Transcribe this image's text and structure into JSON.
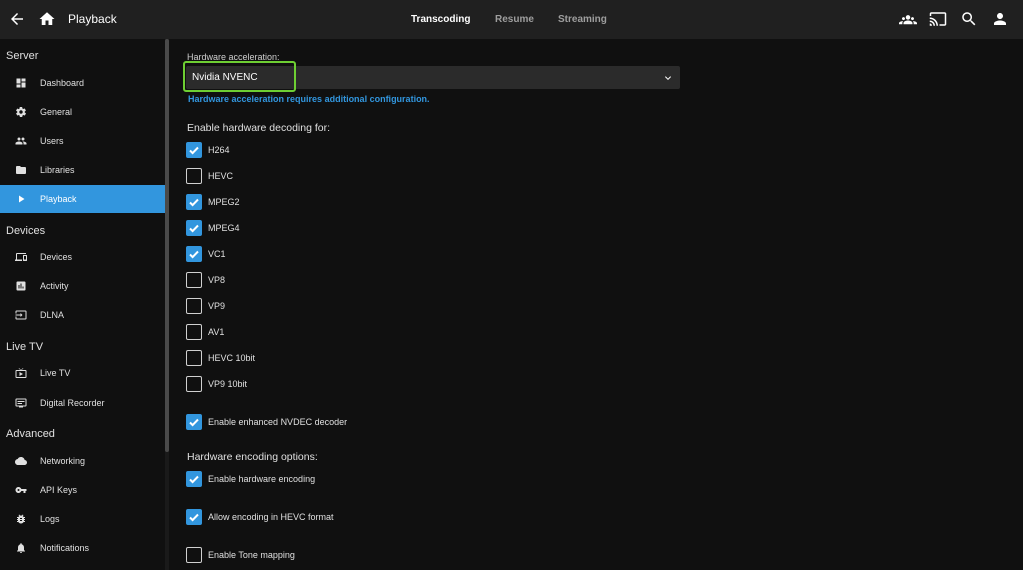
{
  "header": {
    "title": "Playback",
    "tabs": [
      {
        "label": "Transcoding",
        "active": true
      },
      {
        "label": "Resume",
        "active": false
      },
      {
        "label": "Streaming",
        "active": false
      }
    ],
    "icons": [
      "back-arrow-icon",
      "home-icon",
      "users-group-icon",
      "cast-icon",
      "search-icon",
      "account-icon"
    ]
  },
  "sidebar": {
    "sections": [
      {
        "title": "Server",
        "items": [
          {
            "label": "Dashboard",
            "icon": "dashboard-icon"
          },
          {
            "label": "General",
            "icon": "gear-icon"
          },
          {
            "label": "Users",
            "icon": "users-icon"
          },
          {
            "label": "Libraries",
            "icon": "folder-icon"
          },
          {
            "label": "Playback",
            "icon": "play-icon",
            "active": true
          }
        ]
      },
      {
        "title": "Devices",
        "items": [
          {
            "label": "Devices",
            "icon": "devices-icon"
          },
          {
            "label": "Activity",
            "icon": "activity-icon"
          },
          {
            "label": "DLNA",
            "icon": "input-icon"
          }
        ]
      },
      {
        "title": "Live TV",
        "items": [
          {
            "label": "Live TV",
            "icon": "live-tv-icon"
          },
          {
            "label": "Digital Recorder",
            "icon": "recorder-icon"
          }
        ]
      },
      {
        "title": "Advanced",
        "items": [
          {
            "label": "Networking",
            "icon": "cloud-icon"
          },
          {
            "label": "API Keys",
            "icon": "key-icon"
          },
          {
            "label": "Logs",
            "icon": "bug-icon"
          },
          {
            "label": "Notifications",
            "icon": "bell-icon"
          }
        ]
      }
    ]
  },
  "main": {
    "hw_accel_label": "Hardware acceleration:",
    "hw_accel_value": "Nvidia NVENC",
    "hw_accel_help": "Hardware acceleration requires additional configuration.",
    "decoding_label": "Enable hardware decoding for:",
    "codecs": [
      {
        "label": "H264",
        "checked": true
      },
      {
        "label": "HEVC",
        "checked": false
      },
      {
        "label": "MPEG2",
        "checked": true
      },
      {
        "label": "MPEG4",
        "checked": true
      },
      {
        "label": "VC1",
        "checked": true
      },
      {
        "label": "VP8",
        "checked": false
      },
      {
        "label": "VP9",
        "checked": false
      },
      {
        "label": "AV1",
        "checked": false
      },
      {
        "label": "HEVC 10bit",
        "checked": false
      },
      {
        "label": "VP9 10bit",
        "checked": false
      }
    ],
    "nvdec": {
      "label": "Enable enhanced NVDEC decoder",
      "checked": true
    },
    "encoding_label": "Hardware encoding options:",
    "encoding_options": [
      {
        "label": "Enable hardware encoding",
        "checked": true
      },
      {
        "label": "Allow encoding in HEVC format",
        "checked": true
      },
      {
        "label": "Enable Tone mapping",
        "checked": false
      }
    ]
  },
  "colors": {
    "accent": "#3296de",
    "focus": "#6ecf33",
    "header": "#202020",
    "background": "#101010"
  }
}
